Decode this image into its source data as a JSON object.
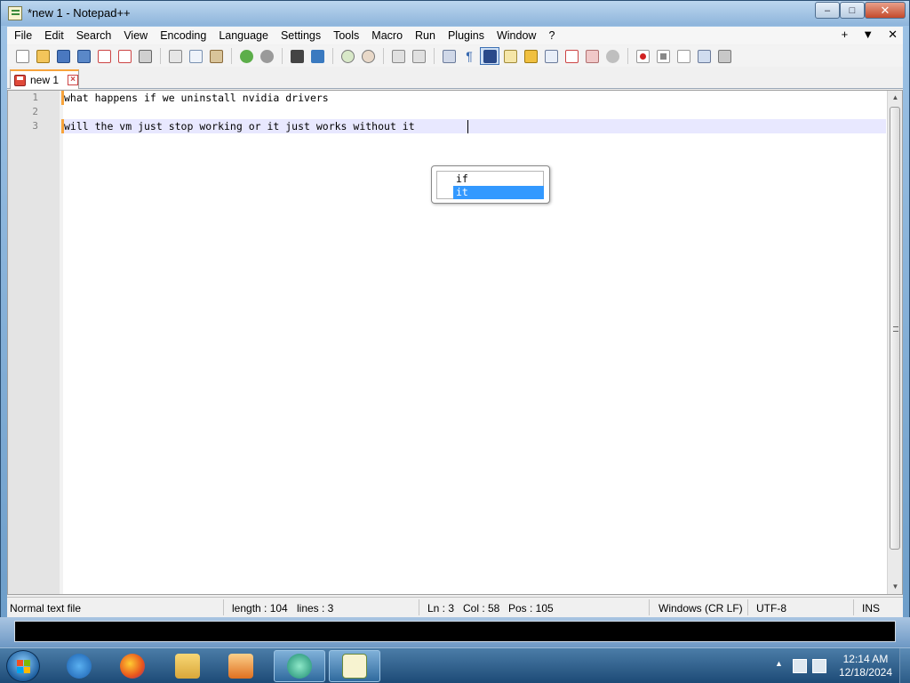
{
  "window": {
    "title": "*new 1 - Notepad++",
    "controls": {
      "minimize": "–",
      "maximize": "□",
      "close": "✕"
    }
  },
  "menu": {
    "items": [
      "File",
      "Edit",
      "Search",
      "View",
      "Encoding",
      "Language",
      "Settings",
      "Tools",
      "Macro",
      "Run",
      "Plugins",
      "Window",
      "?"
    ],
    "right": {
      "plus": "+",
      "arrow": "▼",
      "close": "✕"
    }
  },
  "toolbar": {
    "icons": [
      "new-file-icon",
      "open-file-icon",
      "save-icon",
      "save-all-icon",
      "close-icon",
      "close-all-icon",
      "print-icon",
      "cut-icon",
      "copy-icon",
      "paste-icon",
      "undo-icon",
      "redo-icon",
      "find-icon",
      "replace-icon",
      "zoom-in-icon",
      "zoom-out-icon",
      "sync-vertical-icon",
      "sync-horizontal-icon",
      "word-wrap-icon",
      "show-all-chars-icon",
      "indent-guide-icon",
      "udl-icon",
      "doc-map-icon",
      "doc-list-icon",
      "function-list-icon",
      "folder-workspace-icon",
      "monitoring-icon",
      "record-macro-icon",
      "stop-macro-icon",
      "play-macro-icon",
      "run-multiple-macro-icon",
      "save-macro-icon"
    ]
  },
  "tab": {
    "label": "new 1"
  },
  "editor": {
    "lines": [
      {
        "no": "1",
        "text": "what happens if we uninstall nvidia drivers"
      },
      {
        "no": "2",
        "text": ""
      },
      {
        "no": "3",
        "text": "will the vm just stop working or it just works without it"
      }
    ],
    "autocomplete": {
      "options": [
        "if",
        "it"
      ],
      "selected": "it"
    }
  },
  "status": {
    "type": "Normal text file",
    "length": "length : 104",
    "lines": "lines : 3",
    "ln": "Ln : 3",
    "col": "Col : 58",
    "pos": "Pos : 105",
    "eol": "Windows (CR LF)",
    "encoding": "UTF-8",
    "mode": "INS"
  },
  "taskbar": {
    "clock_time": "12:14 AM",
    "clock_date": "12/18/2024"
  },
  "colors": {
    "accent": "#3399ff",
    "tab_highlight": "#f7a33b",
    "current_line": "#e8e8ff"
  }
}
